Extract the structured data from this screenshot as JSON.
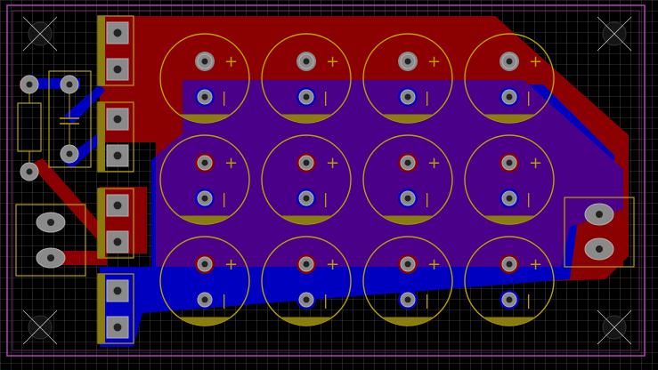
{
  "board": {
    "colors": {
      "background": "#000000",
      "grid": "#6a6a6a",
      "outline": "#b03ab0",
      "top_copper": "#8b0000",
      "bottom_copper": "#0000c0",
      "overlap": "#4a0088",
      "silkscreen": "#b8a200",
      "silk_fill": "#8a7c10",
      "pad": "#8a8a8a",
      "pad_hole": "#222222",
      "pad_ring": "#b0b0b0",
      "mount_hole": "#151515"
    },
    "capacitor_array": {
      "rows": 3,
      "cols": 4
    },
    "markings": {
      "plus": "+",
      "minus": "|"
    },
    "icons": [
      "mounting-hole-icon",
      "capacitor-footprint-icon",
      "pad-icon",
      "connector-footprint-icon"
    ]
  }
}
